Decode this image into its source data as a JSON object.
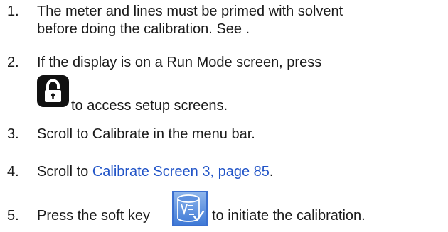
{
  "steps": [
    {
      "number": "1.",
      "line1": "The meter and lines must be primed with solvent",
      "line2": "before doing the calibration. See ."
    },
    {
      "number": "2.",
      "line1": "If the display is on a Run Mode screen, press",
      "icon": "lock-key-icon",
      "line2": "to access setup screens."
    },
    {
      "number": "3.",
      "line1": "Scroll to Calibrate in the menu bar."
    },
    {
      "number": "4.",
      "prefix": "Scroll to ",
      "link": "Calibrate Screen 3, page 85",
      "suffix": "."
    },
    {
      "number": "5.",
      "prefix": "Press the soft key",
      "icon": "calibrate-softkey-icon",
      "suffix": "to initiate the calibration."
    }
  ],
  "colors": {
    "text": "#1a1a1a",
    "link": "#2154c7",
    "key_blue": "#3f79d6"
  }
}
